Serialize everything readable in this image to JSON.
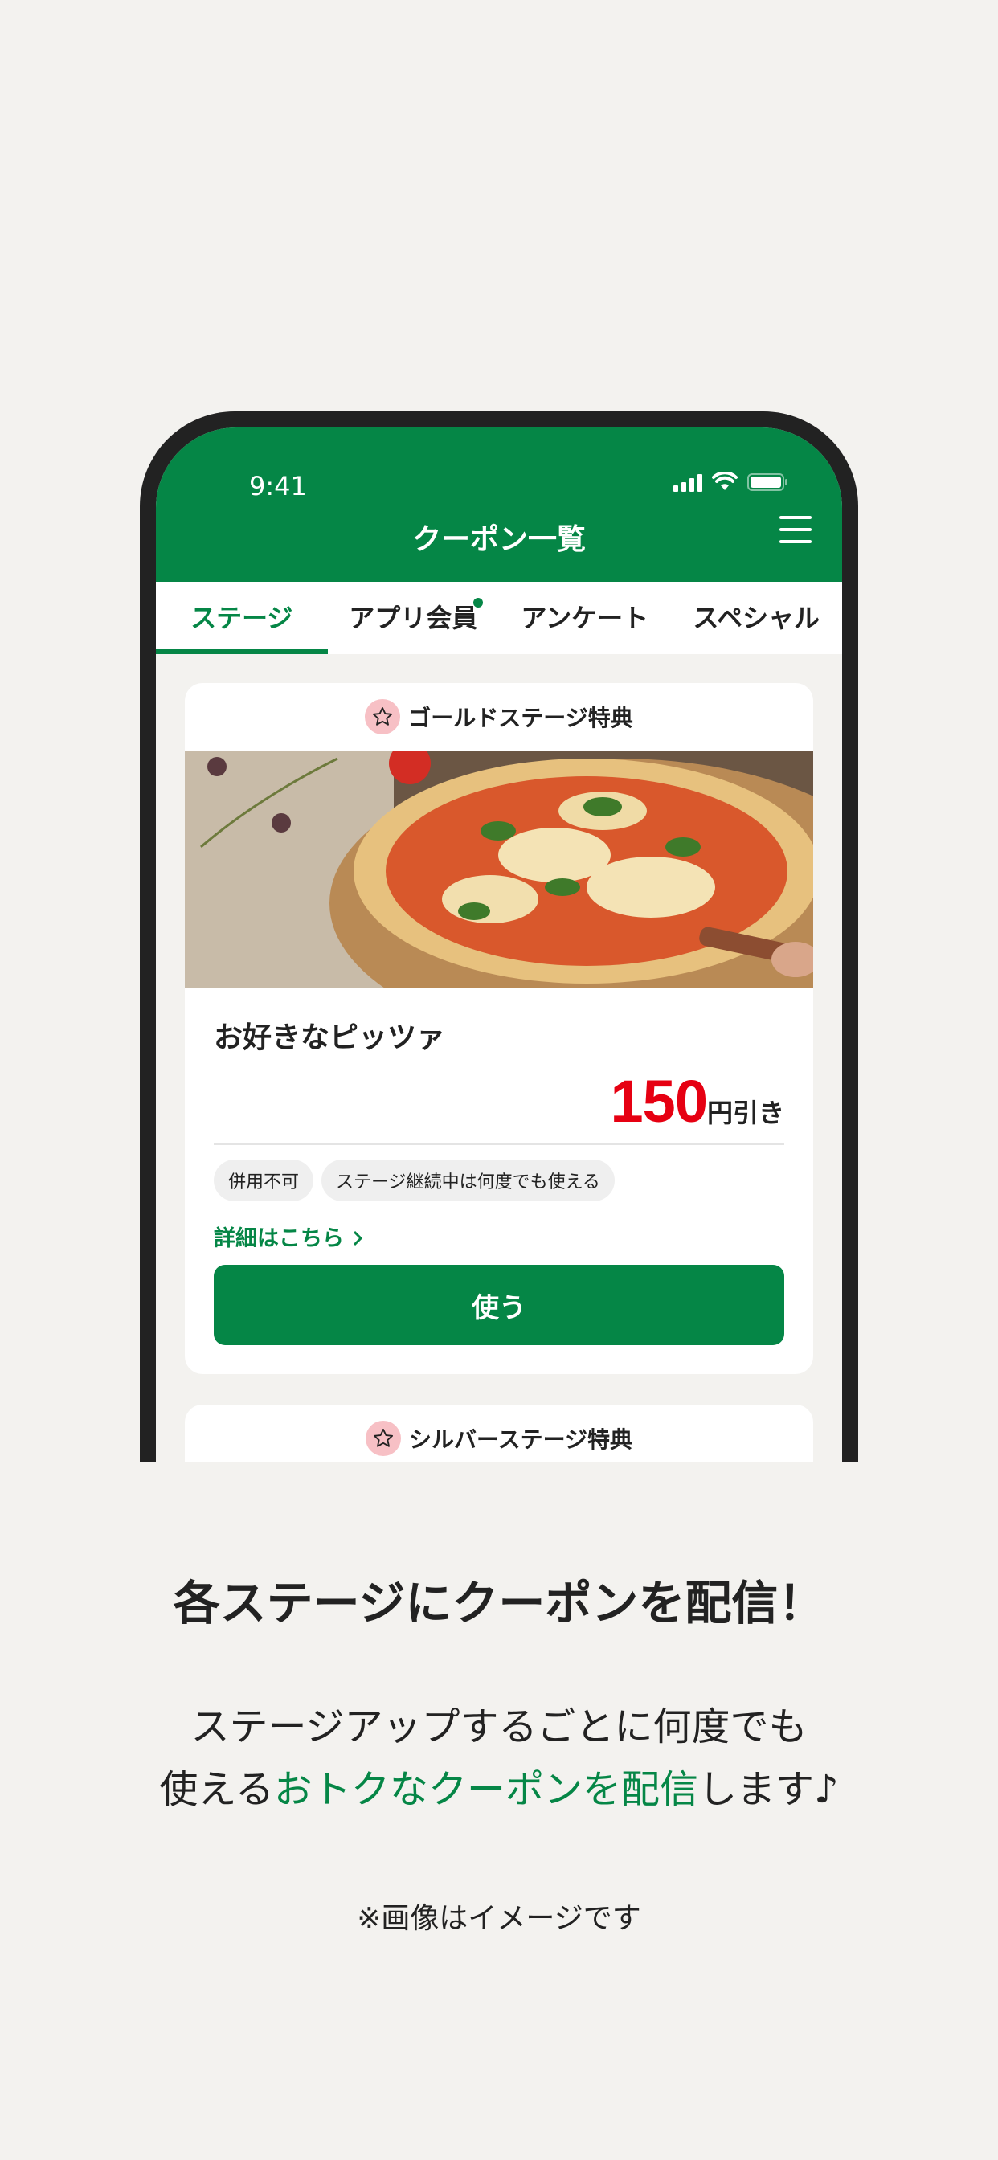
{
  "status_bar": {
    "time": "9:41"
  },
  "app_bar": {
    "title": "クーポン一覧"
  },
  "tabs": [
    {
      "label": "ステージ",
      "active": true
    },
    {
      "label": "アプリ会員",
      "has_dot": true
    },
    {
      "label": "アンケート"
    },
    {
      "label": "スペシャル"
    }
  ],
  "coupons": [
    {
      "stage": "ゴールドステージ特典",
      "title": "お好きなピッツァ",
      "price": "150",
      "price_unit": "円引き",
      "tags": [
        "併用不可",
        "ステージ継続中は何度でも使える"
      ],
      "detail_link": "詳細はこちら",
      "use_button": "使う"
    },
    {
      "stage": "シルバーステージ特典"
    }
  ],
  "headline": "各ステージにクーポンを配信！",
  "description": {
    "line1": "ステージアップするごとに何度でも",
    "line2_prefix": "使える",
    "line2_highlight": "おトクなクーポンを配信",
    "line2_suffix": "します♪"
  },
  "note": "※画像はイメージです",
  "colors": {
    "brand_green": "#058646",
    "price_red": "#e60012",
    "badge_pink": "#f7c0c5"
  }
}
